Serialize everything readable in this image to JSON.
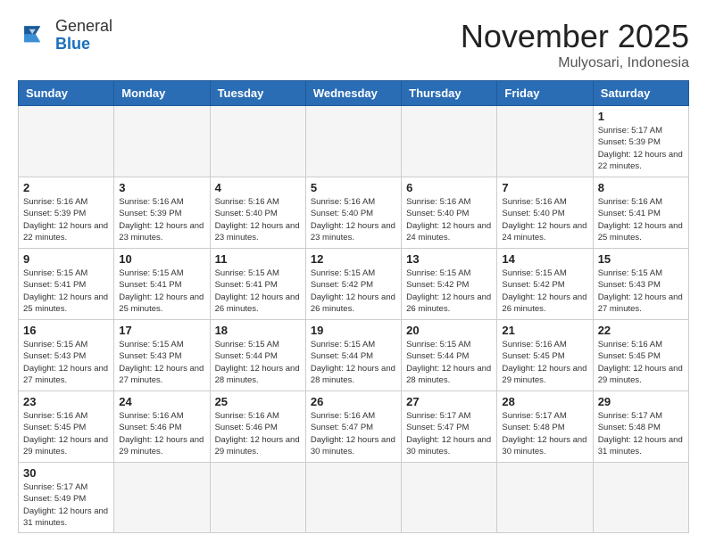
{
  "header": {
    "logo_general": "General",
    "logo_blue": "Blue",
    "month_title": "November 2025",
    "location": "Mulyosari, Indonesia"
  },
  "days_of_week": [
    "Sunday",
    "Monday",
    "Tuesday",
    "Wednesday",
    "Thursday",
    "Friday",
    "Saturday"
  ],
  "weeks": [
    [
      {
        "day": "",
        "info": ""
      },
      {
        "day": "",
        "info": ""
      },
      {
        "day": "",
        "info": ""
      },
      {
        "day": "",
        "info": ""
      },
      {
        "day": "",
        "info": ""
      },
      {
        "day": "",
        "info": ""
      },
      {
        "day": "1",
        "info": "Sunrise: 5:17 AM\nSunset: 5:39 PM\nDaylight: 12 hours\nand 22 minutes."
      }
    ],
    [
      {
        "day": "2",
        "info": "Sunrise: 5:16 AM\nSunset: 5:39 PM\nDaylight: 12 hours\nand 22 minutes."
      },
      {
        "day": "3",
        "info": "Sunrise: 5:16 AM\nSunset: 5:39 PM\nDaylight: 12 hours\nand 23 minutes."
      },
      {
        "day": "4",
        "info": "Sunrise: 5:16 AM\nSunset: 5:40 PM\nDaylight: 12 hours\nand 23 minutes."
      },
      {
        "day": "5",
        "info": "Sunrise: 5:16 AM\nSunset: 5:40 PM\nDaylight: 12 hours\nand 23 minutes."
      },
      {
        "day": "6",
        "info": "Sunrise: 5:16 AM\nSunset: 5:40 PM\nDaylight: 12 hours\nand 24 minutes."
      },
      {
        "day": "7",
        "info": "Sunrise: 5:16 AM\nSunset: 5:40 PM\nDaylight: 12 hours\nand 24 minutes."
      },
      {
        "day": "8",
        "info": "Sunrise: 5:16 AM\nSunset: 5:41 PM\nDaylight: 12 hours\nand 25 minutes."
      }
    ],
    [
      {
        "day": "9",
        "info": "Sunrise: 5:15 AM\nSunset: 5:41 PM\nDaylight: 12 hours\nand 25 minutes."
      },
      {
        "day": "10",
        "info": "Sunrise: 5:15 AM\nSunset: 5:41 PM\nDaylight: 12 hours\nand 25 minutes."
      },
      {
        "day": "11",
        "info": "Sunrise: 5:15 AM\nSunset: 5:41 PM\nDaylight: 12 hours\nand 26 minutes."
      },
      {
        "day": "12",
        "info": "Sunrise: 5:15 AM\nSunset: 5:42 PM\nDaylight: 12 hours\nand 26 minutes."
      },
      {
        "day": "13",
        "info": "Sunrise: 5:15 AM\nSunset: 5:42 PM\nDaylight: 12 hours\nand 26 minutes."
      },
      {
        "day": "14",
        "info": "Sunrise: 5:15 AM\nSunset: 5:42 PM\nDaylight: 12 hours\nand 26 minutes."
      },
      {
        "day": "15",
        "info": "Sunrise: 5:15 AM\nSunset: 5:43 PM\nDaylight: 12 hours\nand 27 minutes."
      }
    ],
    [
      {
        "day": "16",
        "info": "Sunrise: 5:15 AM\nSunset: 5:43 PM\nDaylight: 12 hours\nand 27 minutes."
      },
      {
        "day": "17",
        "info": "Sunrise: 5:15 AM\nSunset: 5:43 PM\nDaylight: 12 hours\nand 27 minutes."
      },
      {
        "day": "18",
        "info": "Sunrise: 5:15 AM\nSunset: 5:44 PM\nDaylight: 12 hours\nand 28 minutes."
      },
      {
        "day": "19",
        "info": "Sunrise: 5:15 AM\nSunset: 5:44 PM\nDaylight: 12 hours\nand 28 minutes."
      },
      {
        "day": "20",
        "info": "Sunrise: 5:15 AM\nSunset: 5:44 PM\nDaylight: 12 hours\nand 28 minutes."
      },
      {
        "day": "21",
        "info": "Sunrise: 5:16 AM\nSunset: 5:45 PM\nDaylight: 12 hours\nand 29 minutes."
      },
      {
        "day": "22",
        "info": "Sunrise: 5:16 AM\nSunset: 5:45 PM\nDaylight: 12 hours\nand 29 minutes."
      }
    ],
    [
      {
        "day": "23",
        "info": "Sunrise: 5:16 AM\nSunset: 5:45 PM\nDaylight: 12 hours\nand 29 minutes."
      },
      {
        "day": "24",
        "info": "Sunrise: 5:16 AM\nSunset: 5:46 PM\nDaylight: 12 hours\nand 29 minutes."
      },
      {
        "day": "25",
        "info": "Sunrise: 5:16 AM\nSunset: 5:46 PM\nDaylight: 12 hours\nand 29 minutes."
      },
      {
        "day": "26",
        "info": "Sunrise: 5:16 AM\nSunset: 5:47 PM\nDaylight: 12 hours\nand 30 minutes."
      },
      {
        "day": "27",
        "info": "Sunrise: 5:17 AM\nSunset: 5:47 PM\nDaylight: 12 hours\nand 30 minutes."
      },
      {
        "day": "28",
        "info": "Sunrise: 5:17 AM\nSunset: 5:48 PM\nDaylight: 12 hours\nand 30 minutes."
      },
      {
        "day": "29",
        "info": "Sunrise: 5:17 AM\nSunset: 5:48 PM\nDaylight: 12 hours\nand 31 minutes."
      }
    ],
    [
      {
        "day": "30",
        "info": "Sunrise: 5:17 AM\nSunset: 5:49 PM\nDaylight: 12 hours\nand 31 minutes."
      },
      {
        "day": "",
        "info": ""
      },
      {
        "day": "",
        "info": ""
      },
      {
        "day": "",
        "info": ""
      },
      {
        "day": "",
        "info": ""
      },
      {
        "day": "",
        "info": ""
      },
      {
        "day": "",
        "info": ""
      }
    ]
  ]
}
